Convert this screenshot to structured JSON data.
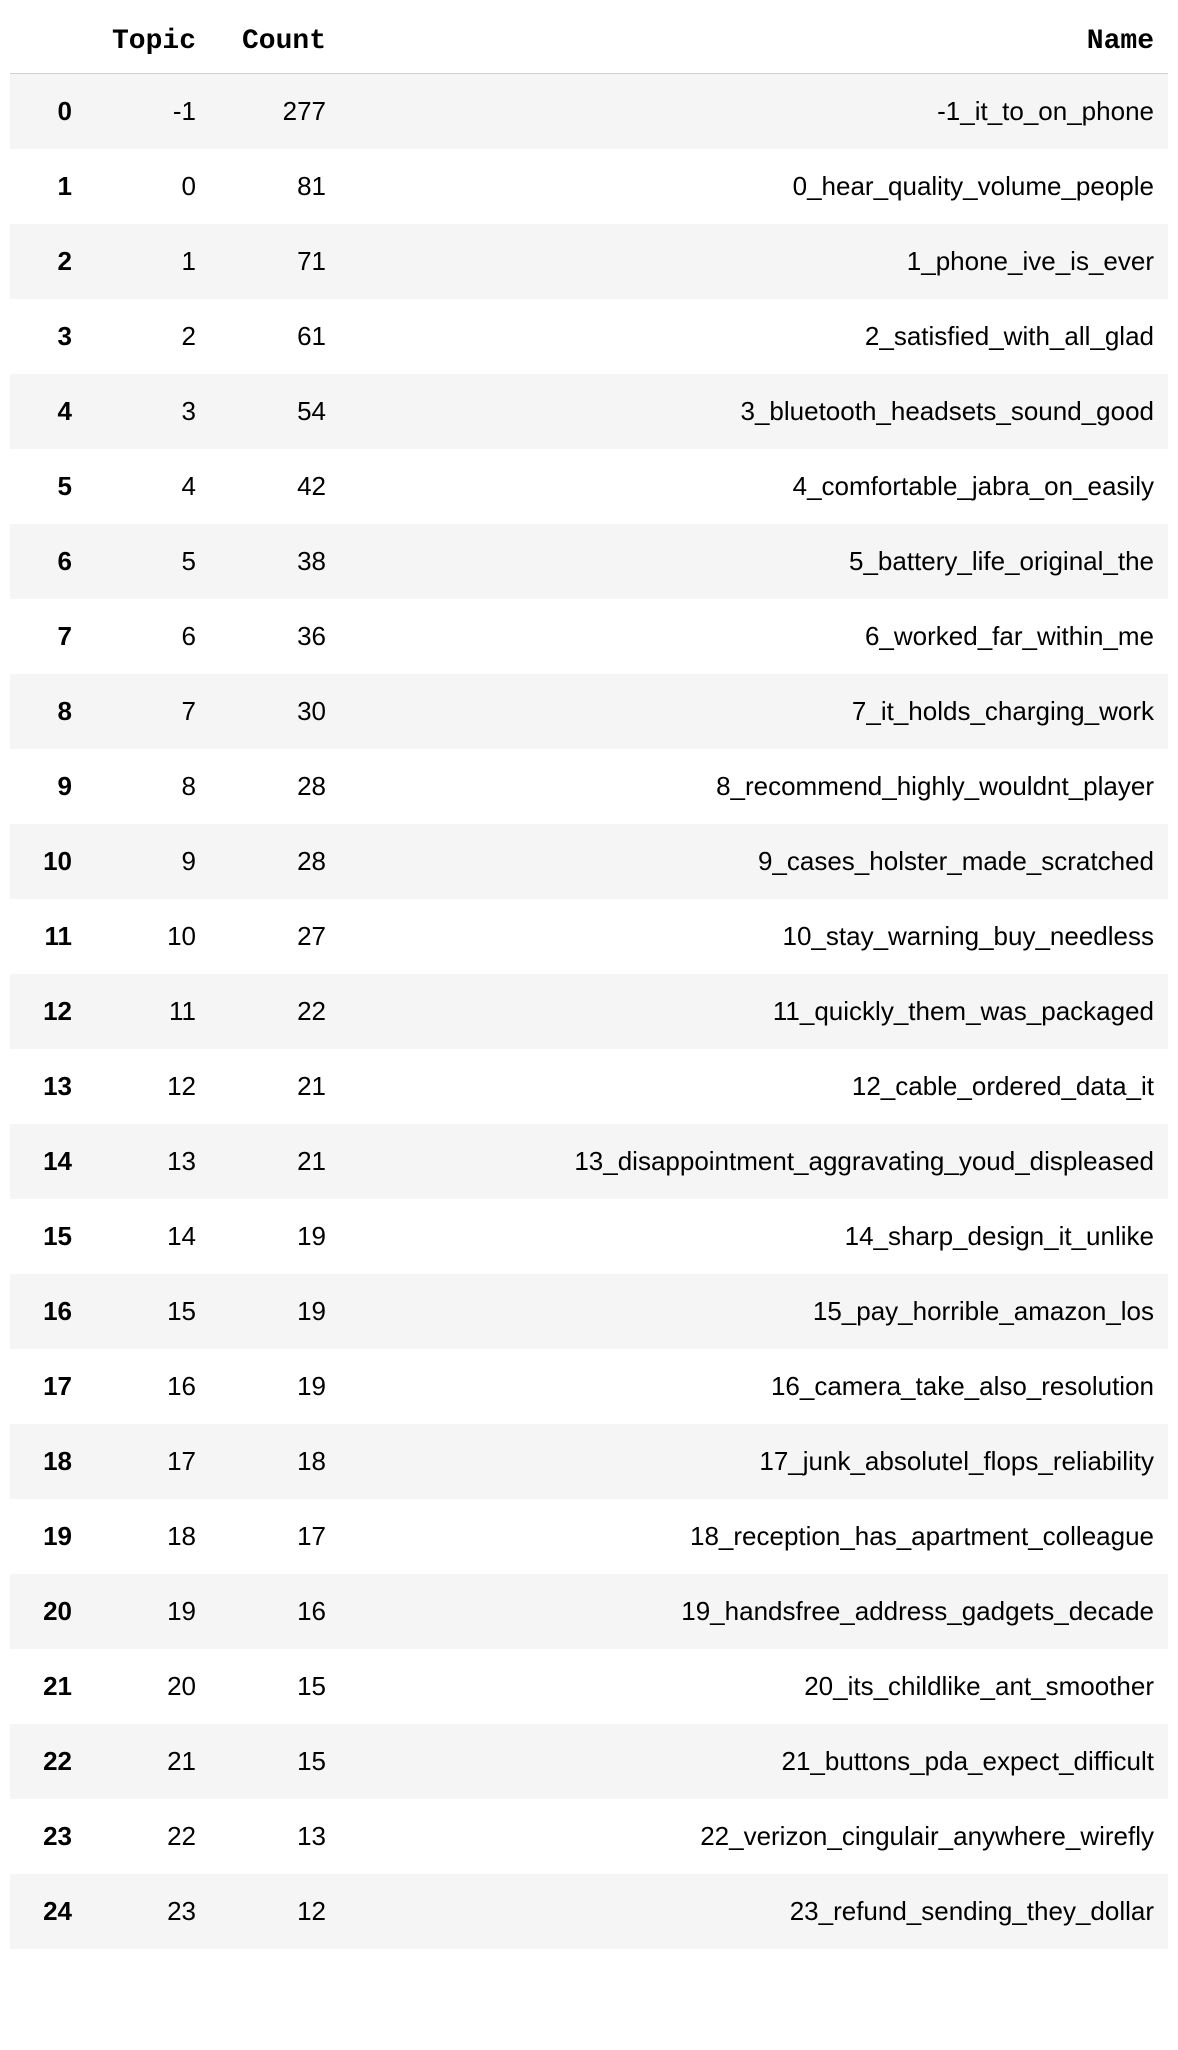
{
  "columns": {
    "index": "",
    "topic": "Topic",
    "count": "Count",
    "name": "Name"
  },
  "rows": [
    {
      "index": "0",
      "topic": "-1",
      "count": "277",
      "name": "-1_it_to_on_phone"
    },
    {
      "index": "1",
      "topic": "0",
      "count": "81",
      "name": "0_hear_quality_volume_people"
    },
    {
      "index": "2",
      "topic": "1",
      "count": "71",
      "name": "1_phone_ive_is_ever"
    },
    {
      "index": "3",
      "topic": "2",
      "count": "61",
      "name": "2_satisfied_with_all_glad"
    },
    {
      "index": "4",
      "topic": "3",
      "count": "54",
      "name": "3_bluetooth_headsets_sound_good"
    },
    {
      "index": "5",
      "topic": "4",
      "count": "42",
      "name": "4_comfortable_jabra_on_easily"
    },
    {
      "index": "6",
      "topic": "5",
      "count": "38",
      "name": "5_battery_life_original_the"
    },
    {
      "index": "7",
      "topic": "6",
      "count": "36",
      "name": "6_worked_far_within_me"
    },
    {
      "index": "8",
      "topic": "7",
      "count": "30",
      "name": "7_it_holds_charging_work"
    },
    {
      "index": "9",
      "topic": "8",
      "count": "28",
      "name": "8_recommend_highly_wouldnt_player"
    },
    {
      "index": "10",
      "topic": "9",
      "count": "28",
      "name": "9_cases_holster_made_scratched"
    },
    {
      "index": "11",
      "topic": "10",
      "count": "27",
      "name": "10_stay_warning_buy_needless"
    },
    {
      "index": "12",
      "topic": "11",
      "count": "22",
      "name": "11_quickly_them_was_packaged"
    },
    {
      "index": "13",
      "topic": "12",
      "count": "21",
      "name": "12_cable_ordered_data_it"
    },
    {
      "index": "14",
      "topic": "13",
      "count": "21",
      "name": "13_disappointment_aggravating_youd_displeased"
    },
    {
      "index": "15",
      "topic": "14",
      "count": "19",
      "name": "14_sharp_design_it_unlike"
    },
    {
      "index": "16",
      "topic": "15",
      "count": "19",
      "name": "15_pay_horrible_amazon_los"
    },
    {
      "index": "17",
      "topic": "16",
      "count": "19",
      "name": "16_camera_take_also_resolution"
    },
    {
      "index": "18",
      "topic": "17",
      "count": "18",
      "name": "17_junk_absolutel_flops_reliability"
    },
    {
      "index": "19",
      "topic": "18",
      "count": "17",
      "name": "18_reception_has_apartment_colleague"
    },
    {
      "index": "20",
      "topic": "19",
      "count": "16",
      "name": "19_handsfree_address_gadgets_decade"
    },
    {
      "index": "21",
      "topic": "20",
      "count": "15",
      "name": "20_its_childlike_ant_smoother"
    },
    {
      "index": "22",
      "topic": "21",
      "count": "15",
      "name": "21_buttons_pda_expect_difficult"
    },
    {
      "index": "23",
      "topic": "22",
      "count": "13",
      "name": "22_verizon_cingulair_anywhere_wirefly"
    },
    {
      "index": "24",
      "topic": "23",
      "count": "12",
      "name": "23_refund_sending_they_dollar"
    }
  ],
  "chart_data": {
    "type": "table",
    "columns": [
      "",
      "Topic",
      "Count",
      "Name"
    ],
    "data": [
      [
        "0",
        -1,
        277,
        "-1_it_to_on_phone"
      ],
      [
        "1",
        0,
        81,
        "0_hear_quality_volume_people"
      ],
      [
        "2",
        1,
        71,
        "1_phone_ive_is_ever"
      ],
      [
        "3",
        2,
        61,
        "2_satisfied_with_all_glad"
      ],
      [
        "4",
        3,
        54,
        "3_bluetooth_headsets_sound_good"
      ],
      [
        "5",
        4,
        42,
        "4_comfortable_jabra_on_easily"
      ],
      [
        "6",
        5,
        38,
        "5_battery_life_original_the"
      ],
      [
        "7",
        6,
        36,
        "6_worked_far_within_me"
      ],
      [
        "8",
        7,
        30,
        "7_it_holds_charging_work"
      ],
      [
        "9",
        8,
        28,
        "8_recommend_highly_wouldnt_player"
      ],
      [
        "10",
        9,
        28,
        "9_cases_holster_made_scratched"
      ],
      [
        "11",
        10,
        27,
        "10_stay_warning_buy_needless"
      ],
      [
        "12",
        11,
        22,
        "11_quickly_them_was_packaged"
      ],
      [
        "13",
        12,
        21,
        "12_cable_ordered_data_it"
      ],
      [
        "14",
        13,
        21,
        "13_disappointment_aggravating_youd_displeased"
      ],
      [
        "15",
        14,
        19,
        "14_sharp_design_it_unlike"
      ],
      [
        "16",
        15,
        19,
        "15_pay_horrible_amazon_los"
      ],
      [
        "17",
        16,
        19,
        "16_camera_take_also_resolution"
      ],
      [
        "18",
        17,
        18,
        "17_junk_absolutel_flops_reliability"
      ],
      [
        "19",
        18,
        17,
        "18_reception_has_apartment_colleague"
      ],
      [
        "20",
        19,
        16,
        "19_handsfree_address_gadgets_decade"
      ],
      [
        "21",
        20,
        15,
        "20_its_childlike_ant_smoother"
      ],
      [
        "22",
        21,
        15,
        "21_buttons_pda_expect_difficult"
      ],
      [
        "23",
        22,
        13,
        "22_verizon_cingulair_anywhere_wirefly"
      ],
      [
        "24",
        23,
        12,
        "23_refund_sending_they_dollar"
      ]
    ]
  }
}
